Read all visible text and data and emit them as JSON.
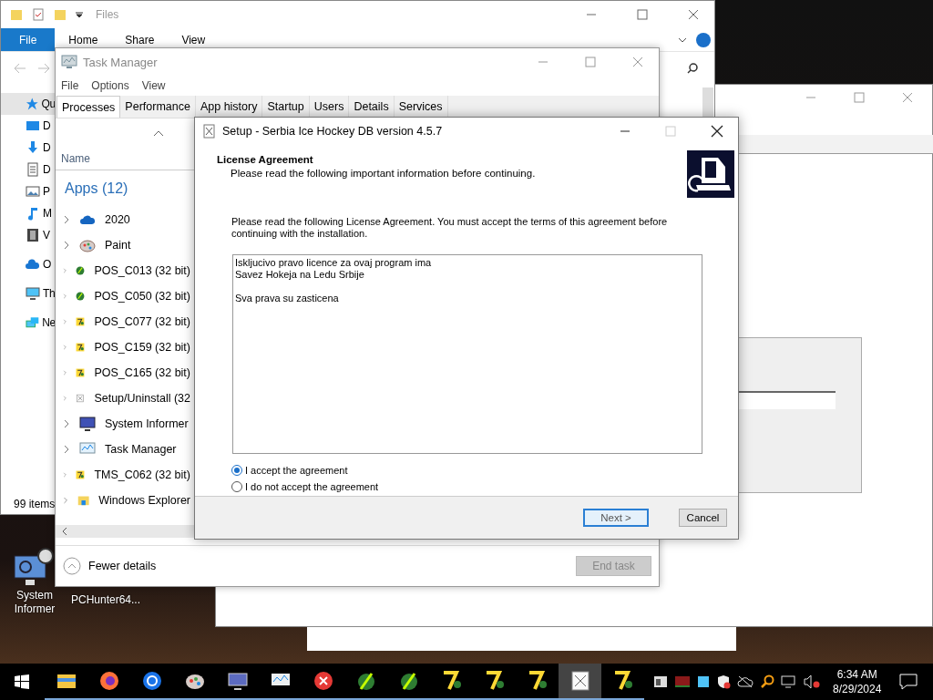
{
  "explorer": {
    "title": "Files",
    "ribbon_tabs": [
      {
        "label": "File",
        "selected": true
      },
      {
        "label": "Home",
        "selected": false
      },
      {
        "label": "Share",
        "selected": false
      },
      {
        "label": "View",
        "selected": false
      }
    ],
    "nav_groups": [
      [
        {
          "label": "Qu",
          "kind": "star",
          "selected": true
        },
        {
          "label": "D",
          "kind": "desktop",
          "selected": false
        },
        {
          "label": "D",
          "kind": "download",
          "selected": false
        },
        {
          "label": "D",
          "kind": "document",
          "selected": false
        },
        {
          "label": "P",
          "kind": "picture",
          "selected": false
        },
        {
          "label": "M",
          "kind": "music",
          "selected": false
        },
        {
          "label": "V",
          "kind": "video",
          "selected": false
        }
      ],
      [
        {
          "label": "O",
          "kind": "cloud",
          "selected": false
        }
      ],
      [
        {
          "label": "Th",
          "kind": "pc",
          "selected": false
        }
      ],
      [
        {
          "label": "Ne",
          "kind": "network",
          "selected": false
        }
      ]
    ],
    "status": "99 items"
  },
  "task_manager": {
    "title": "Task Manager",
    "menu": [
      "File",
      "Options",
      "View"
    ],
    "tabs": [
      {
        "label": "Processes",
        "selected": true
      },
      {
        "label": "Performance",
        "selected": false
      },
      {
        "label": "App history",
        "selected": false
      },
      {
        "label": "Startup",
        "selected": false
      },
      {
        "label": "Users",
        "selected": false
      },
      {
        "label": "Details",
        "selected": false
      },
      {
        "label": "Services",
        "selected": false
      }
    ],
    "column": "Name",
    "group": "Apps (12)",
    "processes": [
      {
        "name": "2020",
        "kind": "cloud"
      },
      {
        "name": "Paint",
        "kind": "paint"
      },
      {
        "name": "POS_C013 (32 bit)",
        "kind": "globe"
      },
      {
        "name": "POS_C050 (32 bit)",
        "kind": "globe"
      },
      {
        "name": "POS_C077 (32 bit)",
        "kind": "seven"
      },
      {
        "name": "POS_C159 (32 bit)",
        "kind": "seven"
      },
      {
        "name": "POS_C165 (32 bit)",
        "kind": "seven"
      },
      {
        "name": "Setup/Uninstall (32",
        "kind": "setup"
      },
      {
        "name": "System Informer",
        "kind": "monitor"
      },
      {
        "name": "Task Manager",
        "kind": "chart"
      },
      {
        "name": "TMS_C062 (32 bit)",
        "kind": "seven"
      },
      {
        "name": "Windows Explorer",
        "kind": "folder"
      }
    ],
    "fewer_details": "Fewer details",
    "end_task": {
      "label": "End task",
      "disabled": true
    }
  },
  "setup": {
    "title": "Setup - Serbia Ice Hockey DB version 4.5.7",
    "heading": "License Agreement",
    "subheading": "Please read the following important information before continuing.",
    "intro": "Please read the following License Agreement. You must accept the terms of this agreement before continuing with the installation.",
    "license_text": "Iskljucivo pravo licence za ovaj program ima\nSavez Hokeja na Ledu Srbije\n\nSva prava su zasticena",
    "options": [
      {
        "label": "I accept the agreement",
        "selected": true
      },
      {
        "label": "I do not accept the agreement",
        "selected": false
      }
    ],
    "buttons": [
      {
        "label": "Next >",
        "kind": "default"
      },
      {
        "label": "Cancel",
        "kind": "normal"
      }
    ]
  },
  "desktop_icons": [
    {
      "label": "System Informer",
      "kind": "app"
    },
    {
      "label": "PCHunter64...",
      "kind": "covered"
    }
  ],
  "taskbar": {
    "apps": [
      {
        "kind": "folder",
        "selected": false
      },
      {
        "kind": "firefox",
        "selected": false
      },
      {
        "kind": "chrome",
        "selected": false
      },
      {
        "kind": "paint",
        "selected": false
      },
      {
        "kind": "monitor",
        "selected": false
      },
      {
        "kind": "chart",
        "selected": false
      },
      {
        "kind": "error",
        "selected": false
      },
      {
        "kind": "globe",
        "selected": false
      },
      {
        "kind": "globe",
        "selected": false
      },
      {
        "kind": "seven",
        "selected": false
      },
      {
        "kind": "seven",
        "selected": false
      },
      {
        "kind": "seven",
        "selected": false
      },
      {
        "kind": "setup",
        "selected": true
      },
      {
        "kind": "seven",
        "selected": false
      }
    ],
    "time": "6:34 AM",
    "date": "8/29/2024"
  }
}
